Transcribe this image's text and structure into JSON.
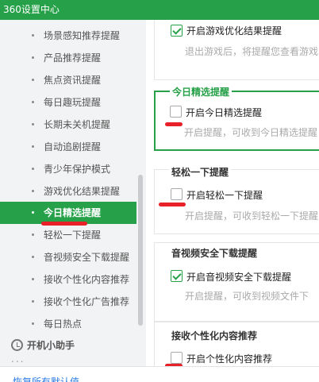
{
  "titlebar": {
    "title": "360设置中心"
  },
  "sidebar": {
    "items": [
      {
        "label": "场景感知推荐提醒"
      },
      {
        "label": "产品推荐提醒"
      },
      {
        "label": "焦点资讯提醒"
      },
      {
        "label": "每日趣玩提醒"
      },
      {
        "label": "长期未关机提醒"
      },
      {
        "label": "自动追剧提醒"
      },
      {
        "label": "青少年保护模式"
      },
      {
        "label": "游戏优化结果提醒"
      },
      {
        "label": "今日精选提醒",
        "active": true
      },
      {
        "label": "轻松一下提醒"
      },
      {
        "label": "音视频安全下载提醒"
      },
      {
        "label": "接收个性化内容推荐"
      },
      {
        "label": "接收个性化广告推荐"
      },
      {
        "label": "每日热点"
      }
    ],
    "group": {
      "label": "开机小助手",
      "icon": "clock-icon"
    },
    "more": "..."
  },
  "sections": {
    "game": {
      "checkbox_label": "开启游戏优化结果提醒",
      "checked": true,
      "hint": "退出游戏后，将提醒您查看游戏"
    },
    "today": {
      "title": "今日精选提醒",
      "checkbox_label": "开启今日精选提醒",
      "checked": false,
      "hint": "开启提醒，可收到今日精选提醒"
    },
    "relax": {
      "title": "轻松一下提醒",
      "checkbox_label": "开启轻松一下提醒",
      "checked": false,
      "hint": "开启提醒，可收到轻松一下提醒"
    },
    "av": {
      "title": "音视频安全下载提醒",
      "checkbox_label": "开启音视频安全下载提醒",
      "checked": true,
      "hint": "开启提醒，可收到视频文件下"
    },
    "personal": {
      "title": "接收个性化内容推荐",
      "checkbox_label": "开启个性化内容推荐",
      "checked": false
    }
  },
  "footer": {
    "restore_link": "恢复所有默认值"
  },
  "colors": {
    "accent": "#27a149",
    "annotation": "#e8202a",
    "link": "#2a7be4"
  }
}
